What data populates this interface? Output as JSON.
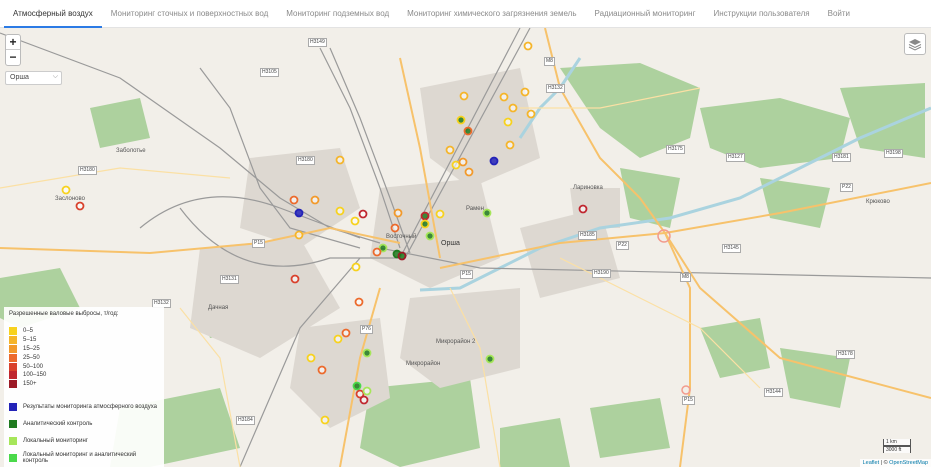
{
  "nav": {
    "tabs": [
      "Атмосферный воздух",
      "Мониторинг сточных и поверхностных вод",
      "Мониторинг подземных вод",
      "Мониторинг химического загрязнения земель",
      "Радиационный мониторинг",
      "Инструкции пользователя",
      "Войти"
    ],
    "active_index": 0
  },
  "map": {
    "zoom_in": "+",
    "zoom_out": "−",
    "city_select": "Орша",
    "layers_icon": "layers-icon",
    "place_labels": {
      "orsha": "Орша",
      "vostochny": "Восточный",
      "mikrorayon2": "Микрорайон 2",
      "mikrorayon": "Микрорайон",
      "dachnaya": "Дачная",
      "larinovka": "Лариновка",
      "kryukovo": "Крюково",
      "zabolotye": "Заболотье",
      "zaslonovo": "Заслоново",
      "ramen": "Рамен"
    },
    "road_labels": [
      "H3149",
      "H3105",
      "H3180",
      "H3180",
      "P15",
      "H3131",
      "H3132",
      "H3132",
      "M8",
      "H3175",
      "H3127",
      "H3181",
      "H3198",
      "P22",
      "H3185",
      "P22",
      "H3145",
      "H3190",
      "M8",
      "P15",
      "H3144",
      "H3178",
      "H3184",
      "P76",
      "P15"
    ]
  },
  "legend": {
    "title": "Разрешенные валовые выбросы, т/год:",
    "scale": [
      {
        "label": "0–5",
        "color": "#f7d21e"
      },
      {
        "label": "5–15",
        "color": "#f5b52a"
      },
      {
        "label": "15–25",
        "color": "#f29a2b"
      },
      {
        "label": "25–50",
        "color": "#ec6a2c"
      },
      {
        "label": "50–100",
        "color": "#d9412c"
      },
      {
        "label": "100–150",
        "color": "#c0262f"
      },
      {
        "label": "150+",
        "color": "#9c1a26"
      }
    ],
    "categories": [
      {
        "label": "Результаты мониторинга атмосферного воздуха",
        "color": "#2323b8"
      },
      {
        "label": "Аналитический контроль",
        "color": "#1f7a1f"
      },
      {
        "label": "Локальный мониторинг",
        "color": "#a6e65a"
      },
      {
        "label": "Локальный мониторинг и аналитический контроль",
        "color": "#4ad94a"
      }
    ]
  },
  "scale_bar": {
    "km": "1 km",
    "ft": "3000 ft"
  },
  "attribution": {
    "leaflet": "Leaflet",
    "sep": " | © ",
    "osm": "OpenStreetMap"
  }
}
